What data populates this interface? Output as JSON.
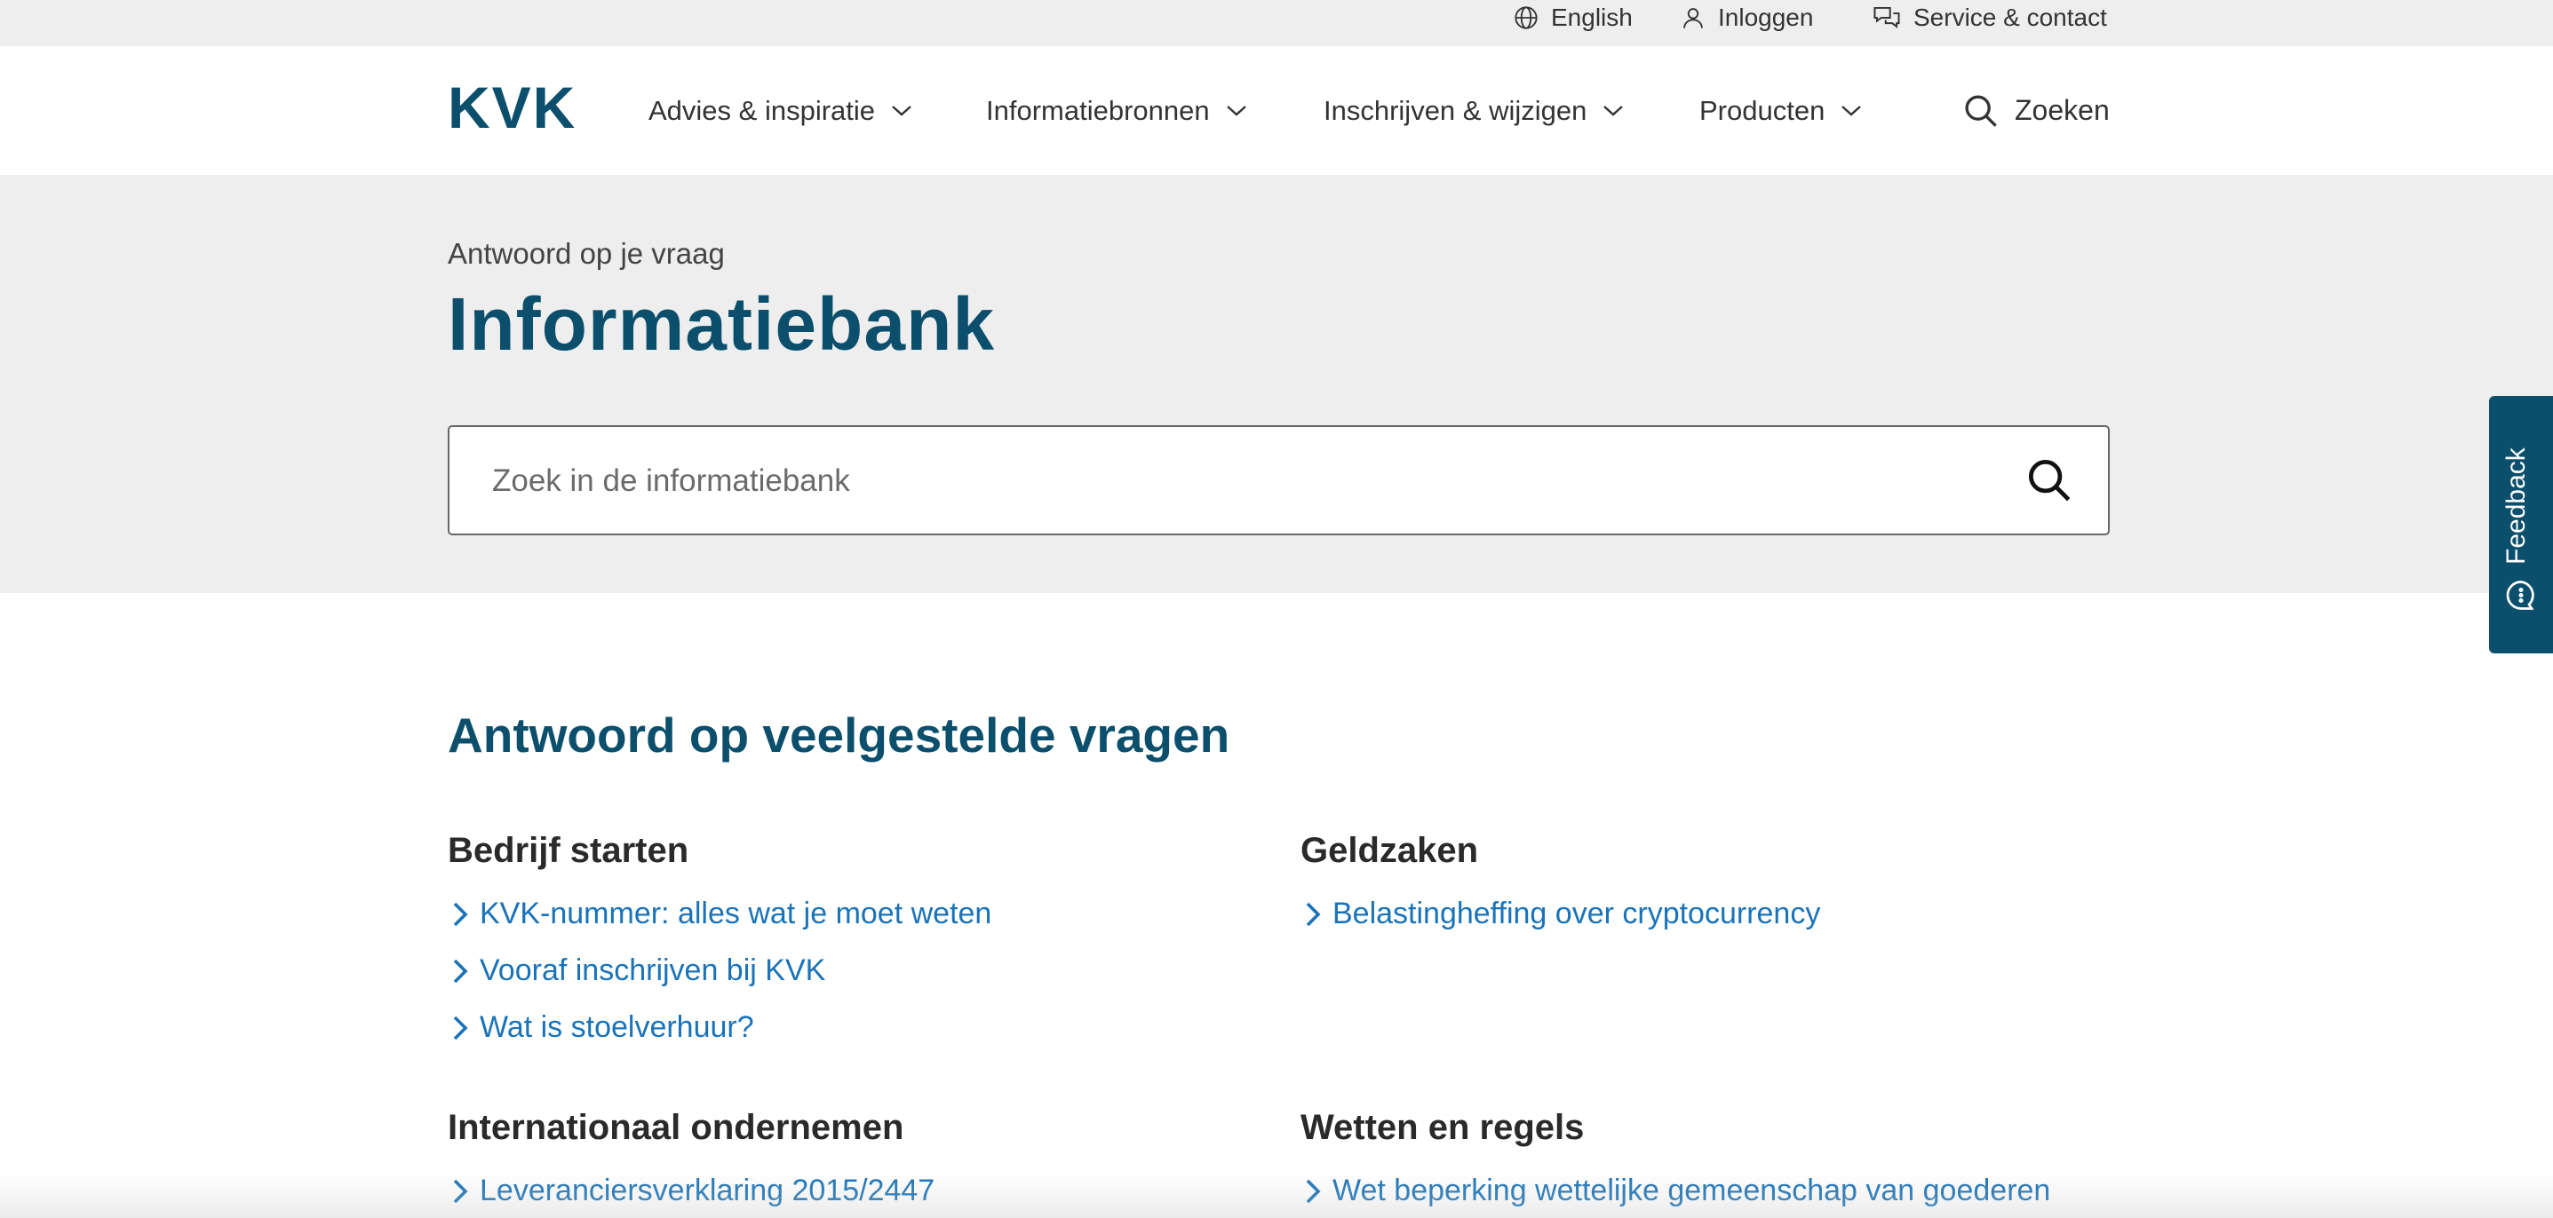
{
  "utility": {
    "language": "English",
    "login": "Inloggen",
    "service": "Service & contact"
  },
  "header": {
    "logo_text": "KVK",
    "nav": [
      {
        "label": "Advies & inspiratie"
      },
      {
        "label": "Informatiebronnen"
      },
      {
        "label": "Inschrijven & wijzigen"
      },
      {
        "label": "Producten"
      }
    ],
    "search_label": "Zoeken"
  },
  "hero": {
    "eyebrow": "Antwoord op je vraag",
    "title": "Informatiebank",
    "search_placeholder": "Zoek in de informatiebank"
  },
  "faq": {
    "title": "Antwoord op veelgestelde vragen",
    "categories": [
      {
        "title": "Bedrijf starten",
        "links": [
          "KVK-nummer: alles wat je moet weten",
          "Vooraf inschrijven bij KVK",
          "Wat is stoelverhuur?"
        ]
      },
      {
        "title": "Geldzaken",
        "links": [
          "Belastingheffing over cryptocurrency"
        ]
      },
      {
        "title": "Internationaal ondernemen",
        "links": [
          "Leveranciersverklaring 2015/2447"
        ]
      },
      {
        "title": "Wetten en regels",
        "links": [
          "Wet beperking wettelijke gemeenschap van goederen"
        ]
      }
    ]
  },
  "feedback": {
    "label": "Feedback"
  },
  "colors": {
    "brand": "#0b4f6c",
    "link": "#1a73b8",
    "hero_bg": "#eeeeee"
  }
}
